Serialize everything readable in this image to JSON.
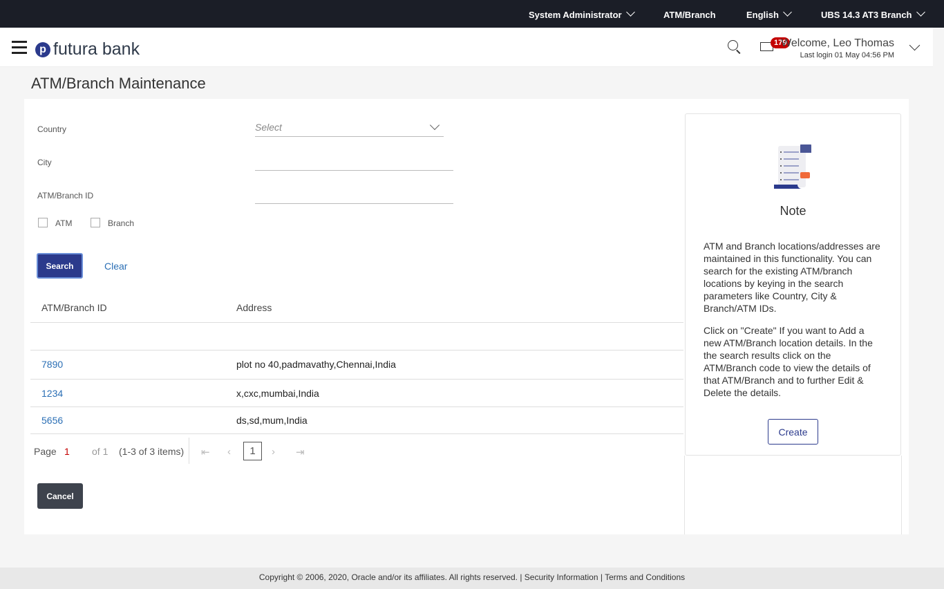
{
  "topbar": {
    "role": "System Administrator",
    "atm_branch": "ATM/Branch",
    "language": "English",
    "entity": "UBS 14.3 AT3 Branch"
  },
  "header": {
    "logo": "futura bank",
    "logo_mark": "p",
    "notifications": "179",
    "welcome": "Welcome, Leo Thomas",
    "last_login": "Last login 01 May 04:56 PM"
  },
  "page": {
    "title": "ATM/Branch Maintenance"
  },
  "form": {
    "country_label": "Country",
    "country_placeholder": "Select",
    "city_label": "City",
    "id_label": "ATM/Branch ID",
    "atm_label": "ATM",
    "branch_label": "Branch",
    "search": "Search",
    "clear": "Clear"
  },
  "table": {
    "headers": [
      "ATM/Branch ID",
      "Address"
    ],
    "rows": [
      {
        "id": "7890",
        "address": "plot no 40,padmavathy,Chennai,India"
      },
      {
        "id": "1234",
        "address": "x,cxc,mumbai,India"
      },
      {
        "id": "5656",
        "address": "ds,sd,mum,India"
      }
    ]
  },
  "pagination": {
    "page_label": "Page",
    "page": "1",
    "of": "of 1",
    "items": "(1-3 of 3 items)",
    "current": "1"
  },
  "cancel": "Cancel",
  "note": {
    "title": "Note",
    "p1": "ATM and Branch locations/addresses are maintained in this functionality. You can search for the existing ATM/branch locations by keying in the search parameters like Country, City & Branch/ATM IDs.",
    "p2": "Click on \"Create\" If you want to Add a new ATM/Branch location details. In the the search results click on the ATM/Branch code to view the details of that ATM/Branch and to further Edit & Delete the details.",
    "create": "Create"
  },
  "footer": "Copyright © 2006, 2020, Oracle and/or its affiliates. All rights reserved. | Security Information | Terms and Conditions"
}
